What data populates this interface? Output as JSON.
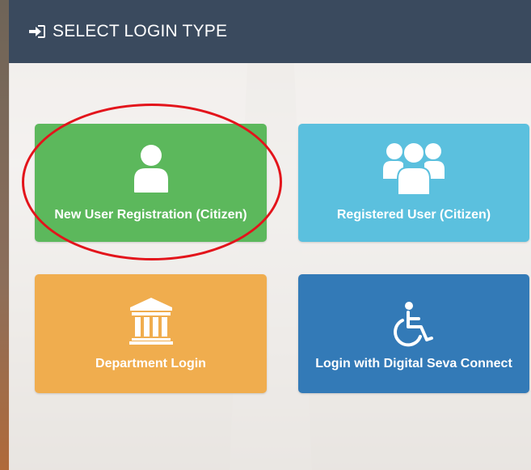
{
  "header": {
    "title": "SELECT LOGIN TYPE",
    "icon": "sign-in-icon",
    "color": "#3a4a5e"
  },
  "tiles": [
    {
      "label": "New User Registration (Citizen)",
      "icon": "user-icon",
      "color": "#5cb85c"
    },
    {
      "label": "Registered User (Citizen)",
      "icon": "users-group-icon",
      "color": "#5bc0de"
    },
    {
      "label": "Department Login",
      "icon": "institution-icon",
      "color": "#f0ad4e"
    },
    {
      "label": "Login with Digital Seva Connect",
      "icon": "wheelchair-icon",
      "color": "#337ab7"
    }
  ],
  "highlight": {
    "color": "#e3141b",
    "target": "New User Registration (Citizen)"
  }
}
